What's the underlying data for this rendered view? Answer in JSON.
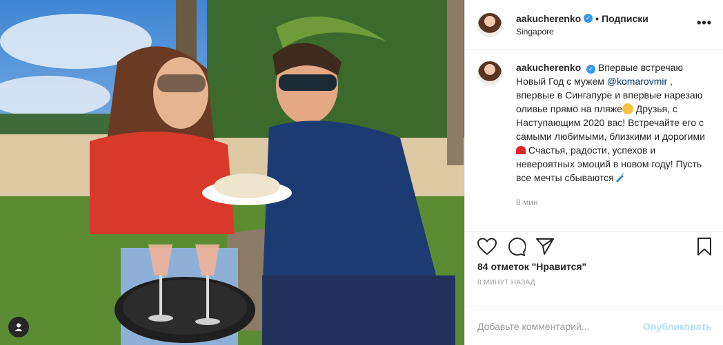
{
  "post": {
    "username": "aakucherenko",
    "follow_separator": "•",
    "follow_label": "Подписки",
    "location": "Singapore",
    "more_label": "•••"
  },
  "caption": {
    "username": "aakucherenko",
    "text_before": "Впервые встречаю Новый Год с мужем ",
    "mention": "@komarovmir",
    "text_middle": " , впервые в Сингапуре и впервые нарезаю оливье прямо на пляже",
    "text_after": "Друзья, с Наступающим 2020 вас! Встречайте его с самыми любимыми, близкими и дорогими ",
    "text_end": " Счастья, радости, успехов и невероятных эмоций в новом году! Пусть все мечты сбываются",
    "time": "8 мин"
  },
  "actions": {
    "like_icon": "heart-icon",
    "comment_icon": "comment-icon",
    "share_icon": "share-icon",
    "save_icon": "bookmark-icon"
  },
  "likes_text": "84 отметок \"Нравится\"",
  "timestamp": "8 МИНУТ НАЗАД",
  "comment_box": {
    "placeholder": "Добавьте комментарий...",
    "publish_label": "Опубликовать"
  },
  "colors": {
    "verified": "#3897f0",
    "mention": "#003569",
    "publish_disabled": "#b2dffc"
  }
}
